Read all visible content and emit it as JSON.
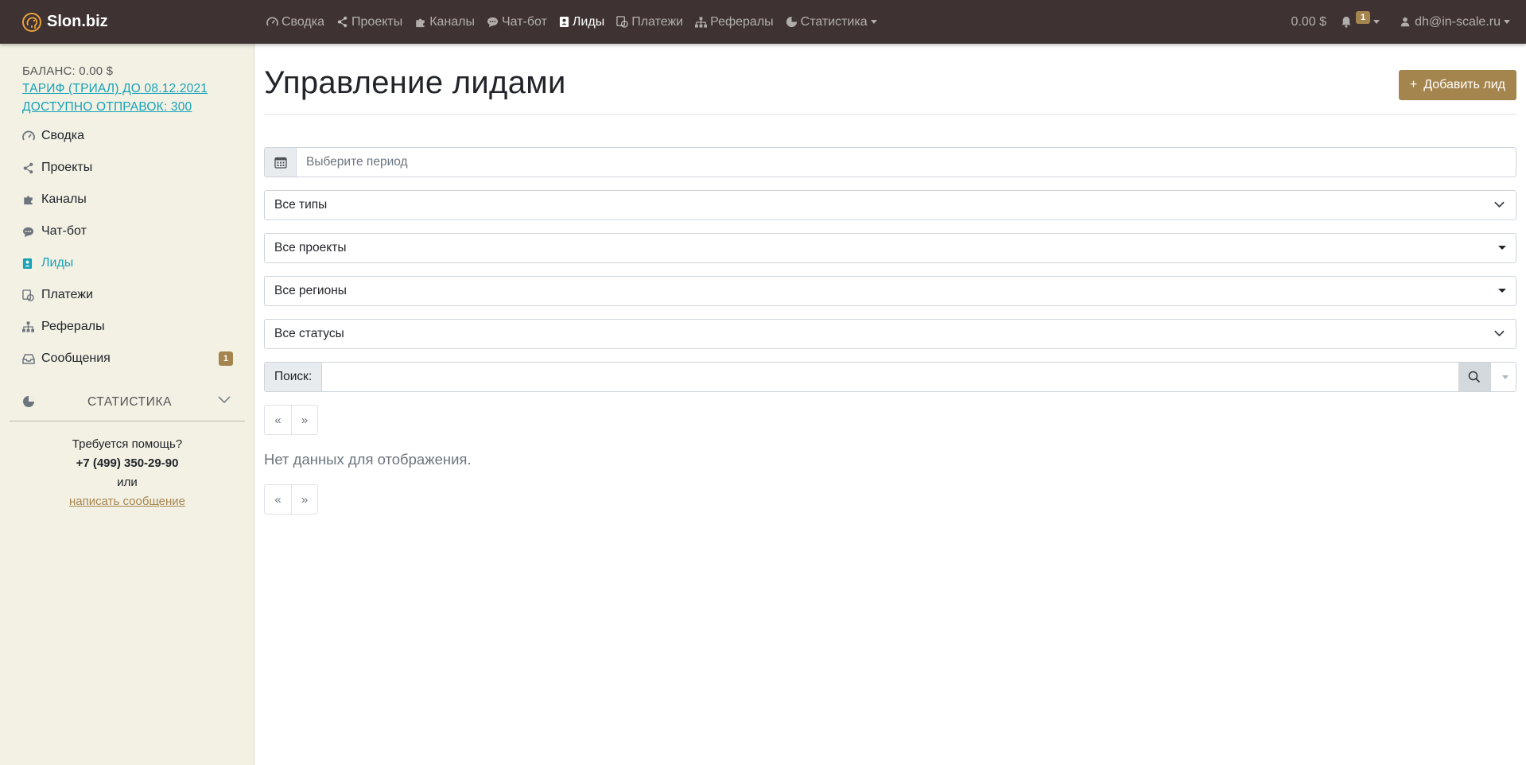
{
  "brand": {
    "name": "Slon.biz"
  },
  "topnav": {
    "items": [
      {
        "label": "Сводка",
        "icon": "dashboard-icon"
      },
      {
        "label": "Проекты",
        "icon": "share-icon"
      },
      {
        "label": "Каналы",
        "icon": "puzzle-icon"
      },
      {
        "label": "Чат-бот",
        "icon": "chat-icon"
      },
      {
        "label": "Лиды",
        "icon": "contact-icon",
        "active": true
      },
      {
        "label": "Платежи",
        "icon": "payments-icon"
      },
      {
        "label": "Рефералы",
        "icon": "sitemap-icon"
      },
      {
        "label": "Статистика",
        "icon": "pie-icon",
        "dropdown": true
      }
    ],
    "balance": "0.00 $",
    "notifications_count": "1",
    "user_email": "dh@in-scale.ru"
  },
  "sidebar": {
    "balance": "БАЛАНС: 0.00 $",
    "tariff": "ТАРИФ (ТРИАЛ) ДО 08.12.2021",
    "available": "ДОСТУПНО ОТПРАВОК: 300",
    "items": [
      {
        "label": "Сводка",
        "icon": "dashboard-icon"
      },
      {
        "label": "Проекты",
        "icon": "share-icon"
      },
      {
        "label": "Каналы",
        "icon": "puzzle-icon"
      },
      {
        "label": "Чат-бот",
        "icon": "chat-icon"
      },
      {
        "label": "Лиды",
        "icon": "contact-icon",
        "active": true
      },
      {
        "label": "Платежи",
        "icon": "payments-icon"
      },
      {
        "label": "Рефералы",
        "icon": "sitemap-icon"
      },
      {
        "label": "Сообщения",
        "icon": "inbox-icon",
        "count": "1"
      }
    ],
    "stats_label": "СТАТИСТИКА",
    "help": {
      "question": "Требуется помощь?",
      "phone": "+7 (499) 350-29-90",
      "or": "или",
      "message_link": "написать сообщение"
    }
  },
  "main": {
    "title": "Управление лидами",
    "add_button": "Добавить лид",
    "period_placeholder": "Выберите период",
    "filters": {
      "types": "Все типы",
      "projects": "Все проекты",
      "regions": "Все регионы",
      "statuses": "Все статусы"
    },
    "search_label": "Поиск:",
    "pager": {
      "prev": "«",
      "next": "»"
    },
    "no_data": "Нет данных для отображения."
  },
  "colors": {
    "navbar": "#3e3232",
    "accent": "#a5854e",
    "link": "#17a2b8",
    "sidebar": "#f3f1e4"
  }
}
